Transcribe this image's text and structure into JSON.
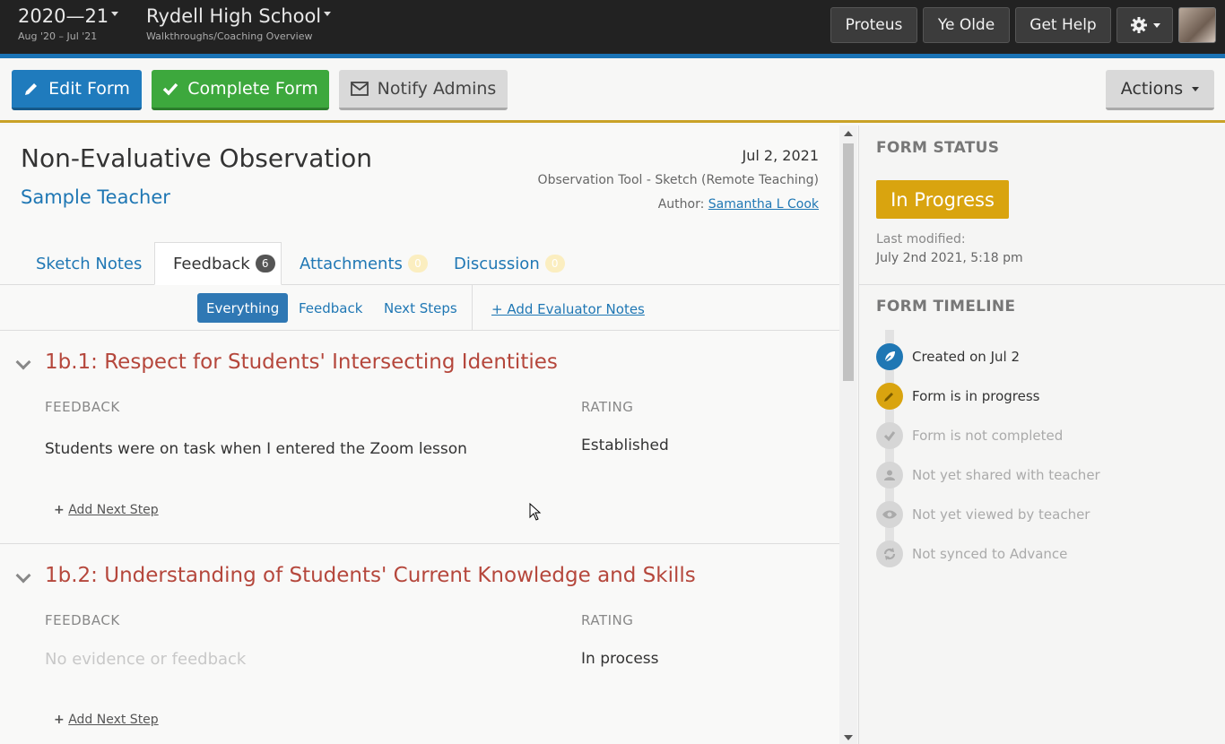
{
  "topbar": {
    "year": "2020—21",
    "year_range": "Aug '20 – Jul '21",
    "school": "Rydell High School",
    "school_sub": "Walkthroughs/Coaching Overview",
    "btn_proteus": "Proteus",
    "btn_yeolde": "Ye Olde",
    "btn_help": "Get Help"
  },
  "toolbar": {
    "edit_label": "Edit Form",
    "complete_label": "Complete Form",
    "notify_label": "Notify Admins",
    "actions_label": "Actions"
  },
  "form": {
    "title": "Non-Evaluative Observation",
    "teacher": "Sample Teacher",
    "date": "Jul 2, 2021",
    "tool": "Observation Tool - Sketch (Remote Teaching)",
    "author_label": "Author:",
    "author_name": "Samantha L Cook"
  },
  "tabs": [
    {
      "label": "Sketch Notes",
      "badge": ""
    },
    {
      "label": "Feedback",
      "badge": "6"
    },
    {
      "label": "Attachments",
      "badge": "0"
    },
    {
      "label": "Discussion",
      "badge": "0"
    }
  ],
  "filters": {
    "everything": "Everything",
    "feedback": "Feedback",
    "next_steps": "Next Steps",
    "add_notes": "+ Add Evaluator Notes"
  },
  "sections": [
    {
      "title": "1b.1: Respect for Students' Intersecting Identities",
      "feedback_head": "FEEDBACK",
      "rating_head": "RATING",
      "feedback": "Students were on task when I entered the Zoom lesson",
      "rating": "Established",
      "add_step": "Add Next Step"
    },
    {
      "title": "1b.2: Understanding of Students' Current Knowledge and Skills",
      "feedback_head": "FEEDBACK",
      "rating_head": "RATING",
      "feedback": "No evidence or feedback",
      "rating": "In process",
      "add_step": "Add Next Step"
    }
  ],
  "side": {
    "status_head": "FORM STATUS",
    "status": "In Progress",
    "status_color": "#d9a40f",
    "lastmod_label": "Last modified:",
    "lastmod_value": "July 2nd 2021, 5:18 pm",
    "timeline_head": "FORM TIMELINE",
    "timeline": [
      {
        "text": "Created on Jul 2",
        "icon": "leaf-icon",
        "color": "#1f77b4",
        "active": true
      },
      {
        "text": "Form is in progress",
        "icon": "pencil-icon",
        "color": "#d9a40f",
        "active": true
      },
      {
        "text": "Form is not completed",
        "icon": "check-icon",
        "color": "#d6d6d6",
        "active": false
      },
      {
        "text": "Not yet shared with teacher",
        "icon": "user-icon",
        "color": "#d6d6d6",
        "active": false
      },
      {
        "text": "Not yet viewed by teacher",
        "icon": "eye-icon",
        "color": "#d6d6d6",
        "active": false
      },
      {
        "text": "Not synced to Advance",
        "icon": "sync-icon",
        "color": "#d6d6d6",
        "active": false
      }
    ]
  }
}
